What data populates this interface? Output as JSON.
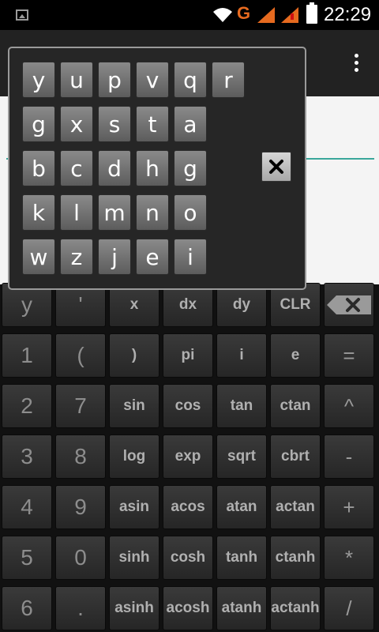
{
  "status_bar": {
    "time": "22:29",
    "network_letter": "G"
  },
  "popup": {
    "rows": [
      [
        "y",
        "u",
        "p",
        "v",
        "q",
        "r"
      ],
      [
        "g",
        "x",
        "s",
        "t",
        "a"
      ],
      [
        "b",
        "c",
        "d",
        "h",
        "g"
      ],
      [
        "k",
        "l",
        "m",
        "n",
        "o"
      ],
      [
        "w",
        "z",
        "j",
        "e",
        "i"
      ]
    ]
  },
  "keypad": {
    "rows": [
      [
        "y",
        "'",
        "x",
        "dx",
        "dy",
        "CLR",
        ""
      ],
      [
        "1",
        "(",
        ")",
        "pi",
        "i",
        "e",
        "="
      ],
      [
        "2",
        "7",
        "sin",
        "cos",
        "tan",
        "ctan",
        "^"
      ],
      [
        "3",
        "8",
        "log",
        "exp",
        "sqrt",
        "cbrt",
        "-"
      ],
      [
        "4",
        "9",
        "asin",
        "acos",
        "atan",
        "actan",
        "+"
      ],
      [
        "5",
        "0",
        "sinh",
        "cosh",
        "tanh",
        "ctanh",
        "*"
      ],
      [
        "6",
        ".",
        "asinh",
        "acosh",
        "atanh",
        "actanh",
        "/"
      ]
    ]
  },
  "icons": {
    "status_image": "image-icon",
    "wifi": "wifi-icon",
    "signal": "signal-icon",
    "battery": "battery-icon",
    "overflow": "overflow-menu-icon",
    "close": "close-icon",
    "backspace": "backspace-icon"
  }
}
